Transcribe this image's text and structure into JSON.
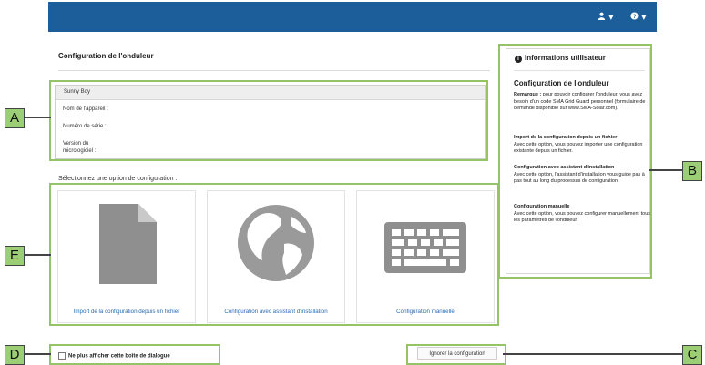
{
  "page": {
    "title": "Configuration de l'onduleur"
  },
  "topbar": {
    "user_icon": "user-icon",
    "help_icon": "help-icon",
    "caret": "▾"
  },
  "device": {
    "name": "Sunny Boy",
    "rows": [
      "Nom de l'appareil :",
      "Numéro de série :",
      "Version du",
      "micrologiciel :"
    ]
  },
  "select_label": "Sélectionnez une option de configuration :",
  "options": [
    {
      "label": "Import de la configuration depuis un fichier",
      "icon": "file-icon"
    },
    {
      "label": "Configuration avec assistant d'installation",
      "icon": "globe-icon"
    },
    {
      "label": "Configuration manuelle",
      "icon": "keyboard-icon"
    }
  ],
  "info": {
    "title": "Informations utilisateur",
    "subtitle": "Configuration de l'onduleur",
    "note_bold": "Remarque :",
    "note": " pour pouvoir configurer l'onduleur, vous avez besoin d'un code SMA Grid Guard personnel (formulaire de demande disponible sur www.SMA-Solar.com).",
    "sections": [
      {
        "heading": "Import de la configuration depuis un fichier",
        "text": "Avec cette option, vous pouvez importer une configuration existante depuis un fichier."
      },
      {
        "heading": "Configuration avec assistant d'installation",
        "text": "Avec cette option, l'assistant d'installation vous guide pas à pas tout au long du processus de configuration."
      },
      {
        "heading": "Configuration manuelle",
        "text": "Avec cette option, vous pouvez configurer manuellement tous les paramètres de l'onduleur."
      }
    ]
  },
  "checkbox_label": "Ne plus afficher cette boîte de dialogue",
  "ignore_button": "Ignorer la configuration",
  "callouts": {
    "a": "A",
    "b": "B",
    "c": "C",
    "d": "D",
    "e": "E"
  },
  "colors": {
    "topbar": "#1b5e9a",
    "callout_green": "#95c468",
    "link_blue": "#2a6cb3"
  }
}
